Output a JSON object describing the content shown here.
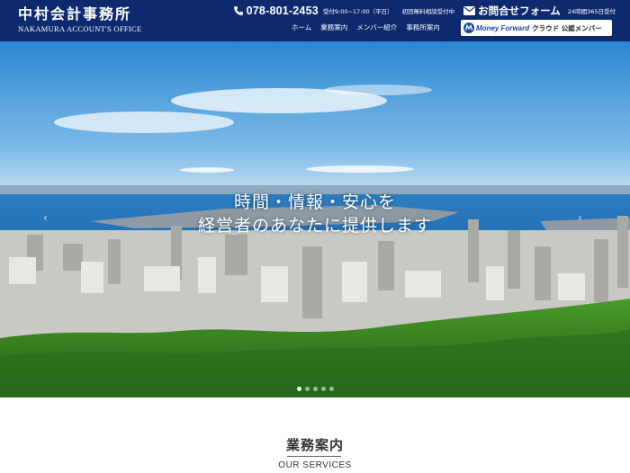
{
  "header": {
    "logo_jp": "中村会計事務所",
    "logo_en": "NAKAMURA ACCOUNT'S OFFICE",
    "phone": "078-801-2453",
    "hours": "受付9:00~17:00（平日）",
    "free_consult": "初回無料相談受付中",
    "contact_label": "お問合せフォーム",
    "contact_hours": "24時間365日受付",
    "nav": [
      "ホーム",
      "業務案内",
      "メンバー紹介",
      "事務所案内"
    ],
    "badge_brand": "Money Forward",
    "badge_text": "クラウド 公認メンバー"
  },
  "hero": {
    "caption_line1": "時間・情報・安心を",
    "caption_line2": "経営者のあなたに提供します",
    "slide_count": 5,
    "active_slide": 1
  },
  "services": {
    "title": "業務案内",
    "subtitle": "OUR SERVICES"
  },
  "colors": {
    "header_bg": "#0e2a6f",
    "sky_top": "#2a87cf",
    "sea": "#1f6db5",
    "forest": "#2f7f1f"
  }
}
